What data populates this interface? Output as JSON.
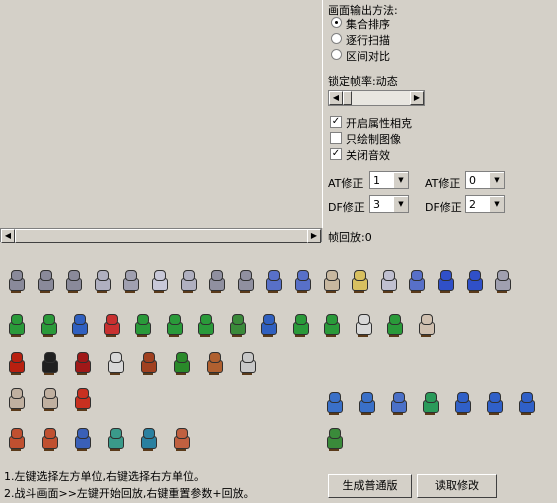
{
  "output_method": {
    "title": "画面输出方法:",
    "options": [
      {
        "label": "集合排序",
        "selected": true
      },
      {
        "label": "逐行扫描",
        "selected": false
      },
      {
        "label": "区间对比",
        "selected": false
      }
    ]
  },
  "framerate": {
    "label": "锁定帧率:动态"
  },
  "checkboxes": [
    {
      "label": "开启属性相克",
      "checked": true
    },
    {
      "label": "只绘制图像",
      "checked": false
    },
    {
      "label": "关闭音效",
      "checked": true
    }
  ],
  "params": {
    "left_at": {
      "label": "AT修正",
      "value": "1"
    },
    "right_at": {
      "label": "AT修正",
      "value": "0"
    },
    "left_df": {
      "label": "DF修正",
      "value": "3"
    },
    "right_df": {
      "label": "DF修正",
      "value": "2"
    }
  },
  "replay": {
    "label": "帧回放:0"
  },
  "instructions": [
    "1.左键选择左方单位,右键选择右方单位。",
    "2.战斗画面>>左键开始回放,右键重置参数+回放。"
  ],
  "buttons": {
    "generate": "生成普通版",
    "read": "读取修改"
  },
  "colors": {
    "background": "#d4d0c8",
    "row1": [
      "#8a8a9a",
      "#8a8a9a",
      "#8a8a9a",
      "#b0b0c0",
      "#a0a0b0",
      "#c8c8d8",
      "#b0b0c0",
      "#9090a0",
      "#9090a0",
      "#5870c8",
      "#5870c8",
      "#c8b8a0",
      "#d8c060",
      "#c0c0d0",
      "#5870c8",
      "#3050c8",
      "#3050c8",
      "#a0a0b0"
    ],
    "row2": [
      "#2a9a3a",
      "#2a9a3a",
      "#3060c0",
      "#c83030",
      "#2a9a3a",
      "#2a9a3a",
      "#2a9a3a",
      "#3a8a3a",
      "#3060c0",
      "#2a9a3a",
      "#2a9a3a",
      "#d8d8d8",
      "#2a9a3a",
      "#d0c0b0"
    ],
    "row3": [
      "#b82010",
      "#202020",
      "#a01818",
      "#d8d8d8",
      "#a04020",
      "#2a8a2a",
      "#b06030",
      "#c8c8c8"
    ],
    "row4": [
      "#c0b0a0",
      "#c0b0a0",
      "#c83020"
    ],
    "row4r": [
      "#3a70c8",
      "#3a70c8",
      "#4a70c8",
      "#2a9a5a",
      "#3060c8",
      "#3060c8",
      "#3060c8"
    ],
    "row5": [
      "#c05030",
      "#c05030",
      "#3a60b8",
      "#3a9a8a",
      "#2a80a0",
      "#c06040"
    ],
    "row5r": [
      "#3a8a3a"
    ]
  }
}
